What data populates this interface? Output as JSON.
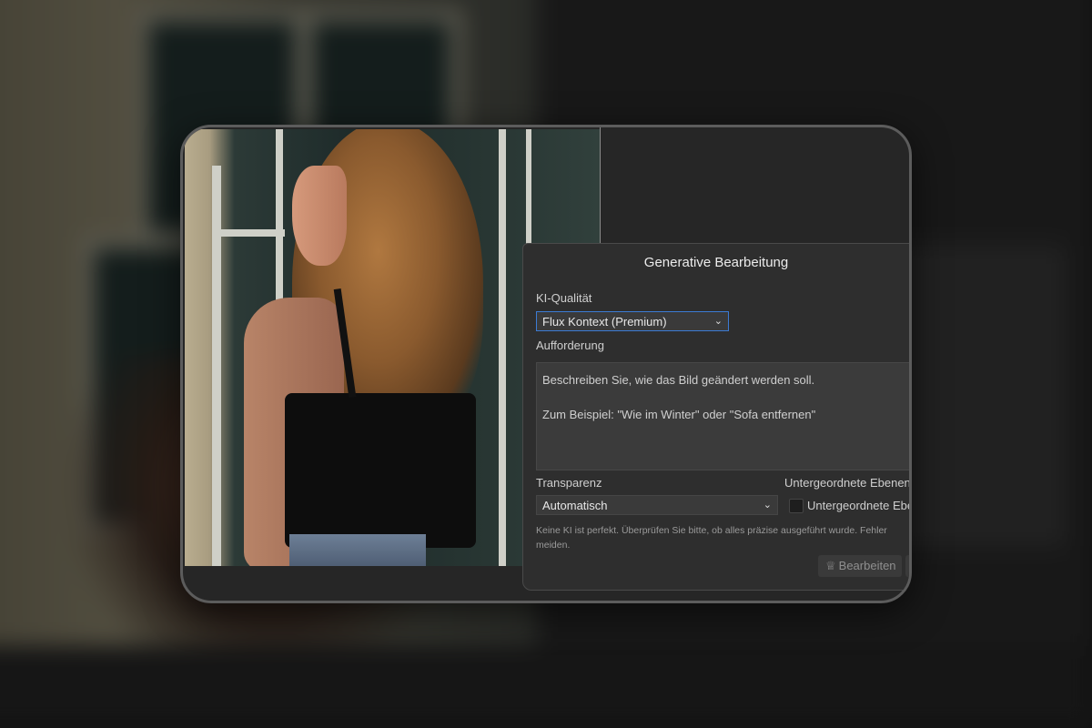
{
  "dialog": {
    "title": "Generative Bearbeitung",
    "quality_label": "KI-Qualität",
    "quality_value": "Flux Kontext (Premium)",
    "prompt_label": "Aufforderung",
    "prompt_placeholder": "Beschreiben Sie, wie das Bild geändert werden soll.\n\nZum Beispiel: \"Wie im Winter\" oder \"Sofa entfernen\"",
    "transparency_label": "Transparenz",
    "transparency_value": "Automatisch",
    "sublayers_label": "Untergeordnete Ebenen",
    "sublayers_checkbox_label": "Untergeordnete Ebenen",
    "note": "Keine KI ist perfekt. Überprüfen Sie bitte, ob alles präzise ausgeführt wurde. Fehler meiden.",
    "edit_button": "Bearbeiten"
  },
  "icons": {
    "chevron": "chevron-down-icon",
    "crown": "crown-icon"
  },
  "colors": {
    "accent": "#3c7bd4",
    "dialog_bg": "#2e2e2e",
    "window_border": "#5c5c5c"
  }
}
